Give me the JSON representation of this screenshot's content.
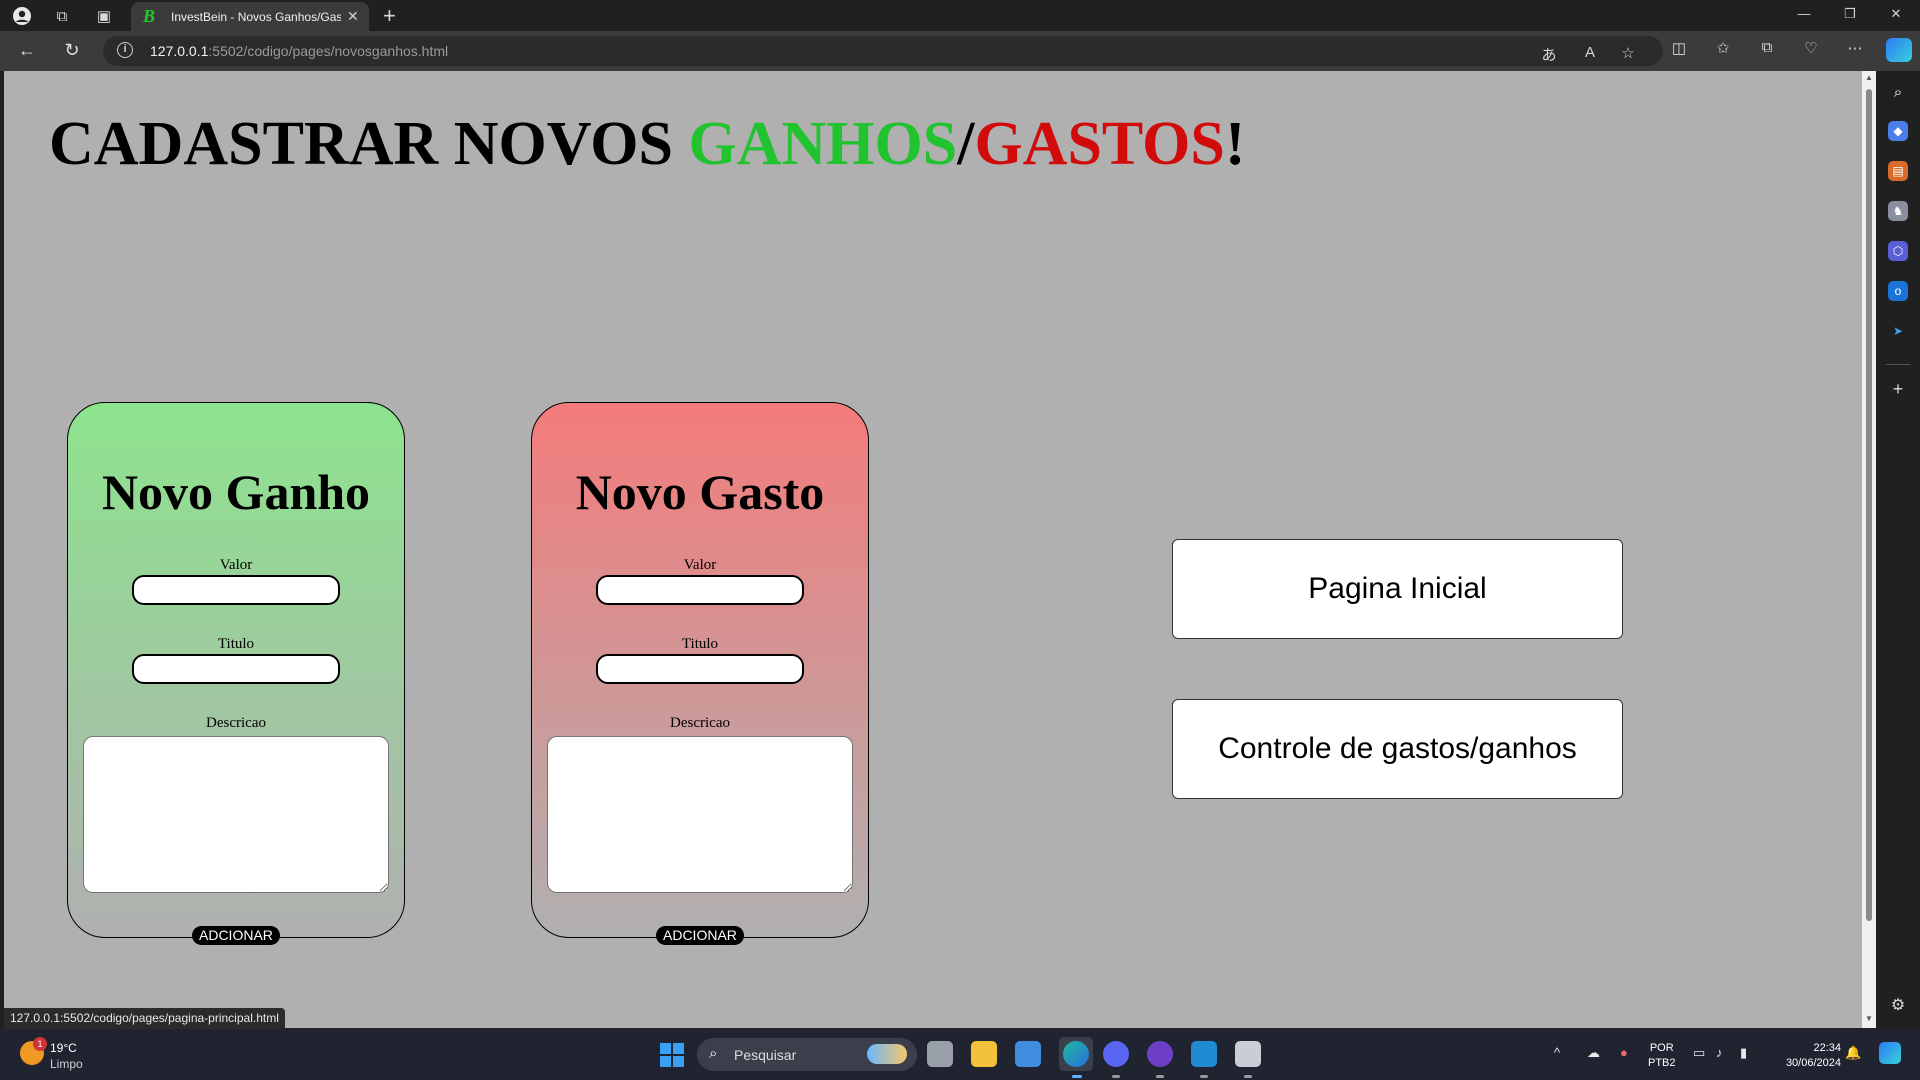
{
  "browser": {
    "tab_title": "InvestBein - Novos Ganhos/Gastos",
    "tab_favicon": "B",
    "url_host": "127.0.0.1",
    "url_rest": ":5502/codigo/pages/novosganhos.html",
    "status_url": "127.0.0.1:5502/codigo/pages/pagina-principal.html"
  },
  "page": {
    "heading": {
      "part1": "CADASTRAR NOVOS ",
      "ganhos": "GANHOS",
      "slash": "/",
      "gastos": "GASTOS",
      "excl": "!"
    },
    "ganho_form": {
      "title": "Novo Ganho",
      "valor_label": "Valor",
      "titulo_label": "Titulo",
      "descricao_label": "Descricao",
      "button": "ADCIONAR",
      "gradient_top": "#8de48e"
    },
    "gasto_form": {
      "title": "Novo Gasto",
      "valor_label": "Valor",
      "titulo_label": "Titulo",
      "descricao_label": "Descricao",
      "button": "ADCIONAR",
      "gradient_top": "#f47b7b"
    },
    "nav": {
      "home": "Pagina Inicial",
      "control": "Controle de gastos/ganhos"
    },
    "colors": {
      "ganhos": "#21c32f",
      "gastos": "#d10a0a",
      "page_bg": "#b0b0b0"
    }
  },
  "taskbar": {
    "weather_temp": "19°C",
    "weather_desc": "Limpo",
    "weather_badge": "1",
    "search_placeholder": "Pesquisar",
    "lang1": "POR",
    "lang2": "PTB2",
    "time": "22:34",
    "date": "30/06/2024"
  }
}
